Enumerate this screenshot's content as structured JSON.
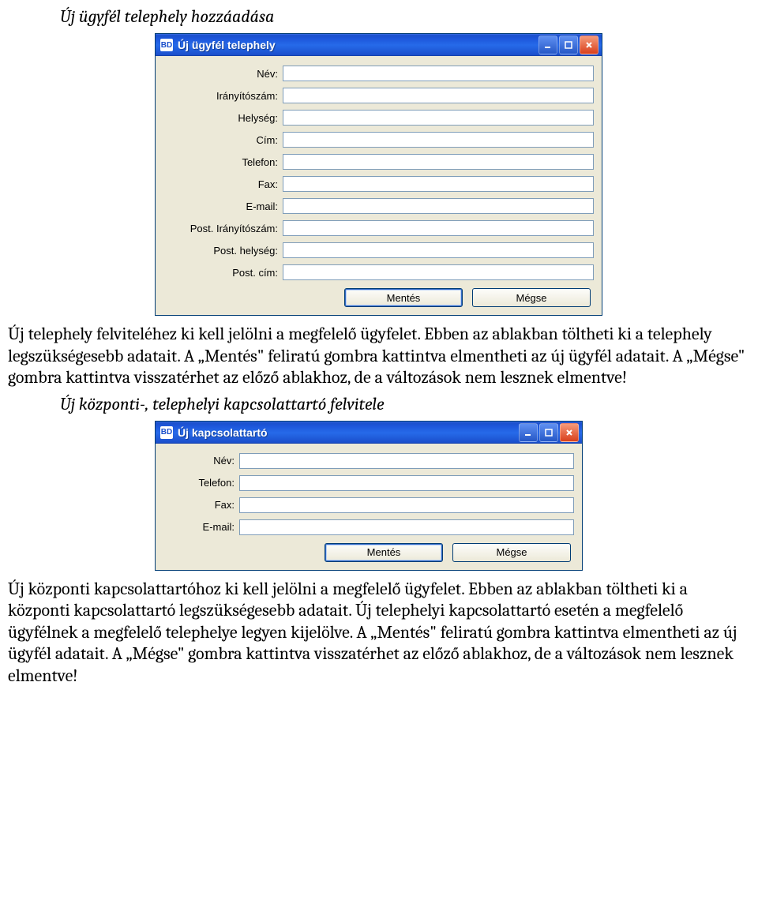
{
  "section1": {
    "heading": "Új ügyfél telephely hozzáadása",
    "paragraph": "Új telephely felviteléhez ki kell jelölni a megfelelő ügyfelet. Ebben az ablakban töltheti ki a telephely legszükségesebb adatait.\nA „Mentés\" feliratú gombra kattintva elmentheti az új ügyfél adatait. A „Mégse\" gombra kattintva visszatérhet az előző ablakhoz, de a változások nem lesznek elmentve!"
  },
  "window1": {
    "app_icon": "BD",
    "title": "Új ügyfél telephely",
    "fields": [
      {
        "label": "Név:",
        "value": ""
      },
      {
        "label": "Irányítószám:",
        "value": ""
      },
      {
        "label": "Helység:",
        "value": ""
      },
      {
        "label": "Cím:",
        "value": ""
      },
      {
        "label": "Telefon:",
        "value": ""
      },
      {
        "label": "Fax:",
        "value": ""
      },
      {
        "label": "E-mail:",
        "value": ""
      },
      {
        "label": "Post. Irányítószám:",
        "value": ""
      },
      {
        "label": "Post. helység:",
        "value": ""
      },
      {
        "label": "Post. cím:",
        "value": ""
      }
    ],
    "save": "Mentés",
    "cancel": "Mégse"
  },
  "section2": {
    "heading": "Új központi-, telephelyi kapcsolattartó felvitele",
    "paragraph": "Új központi kapcsolattartóhoz ki kell jelölni a megfelelő ügyfelet. Ebben az ablakban töltheti ki a központi kapcsolattartó legszükségesebb adatait. Új telephelyi kapcsolattartó esetén a megfelelő ügyfélnek a megfelelő telephelye legyen kijelölve.\nA „Mentés\" feliratú gombra kattintva elmentheti az új ügyfél adatait. A „Mégse\" gombra kattintva visszatérhet az előző ablakhoz, de a változások nem lesznek elmentve!"
  },
  "window2": {
    "app_icon": "BD",
    "title": "Új kapcsolattartó",
    "fields": [
      {
        "label": "Név:",
        "value": ""
      },
      {
        "label": "Telefon:",
        "value": ""
      },
      {
        "label": "Fax:",
        "value": ""
      },
      {
        "label": "E-mail:",
        "value": ""
      }
    ],
    "save": "Mentés",
    "cancel": "Mégse"
  }
}
